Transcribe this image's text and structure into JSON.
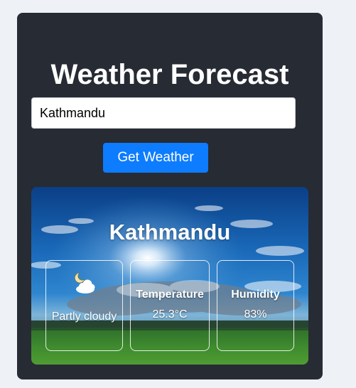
{
  "app": {
    "title": "Weather Forecast"
  },
  "search": {
    "value": "Kathmandu",
    "button_label": "Get Weather"
  },
  "result": {
    "city": "Kathmandu",
    "condition": {
      "icon": "partly-cloudy-night-icon",
      "text": "Partly cloudy"
    },
    "temperature": {
      "label": "Temperature",
      "value": "25.3°C"
    },
    "humidity": {
      "label": "Humidity",
      "value": "83%"
    }
  },
  "colors": {
    "page_background": "#eef1f5",
    "card_background": "#272b33",
    "button_background": "#0d7cff",
    "text_primary": "#ffffff"
  }
}
